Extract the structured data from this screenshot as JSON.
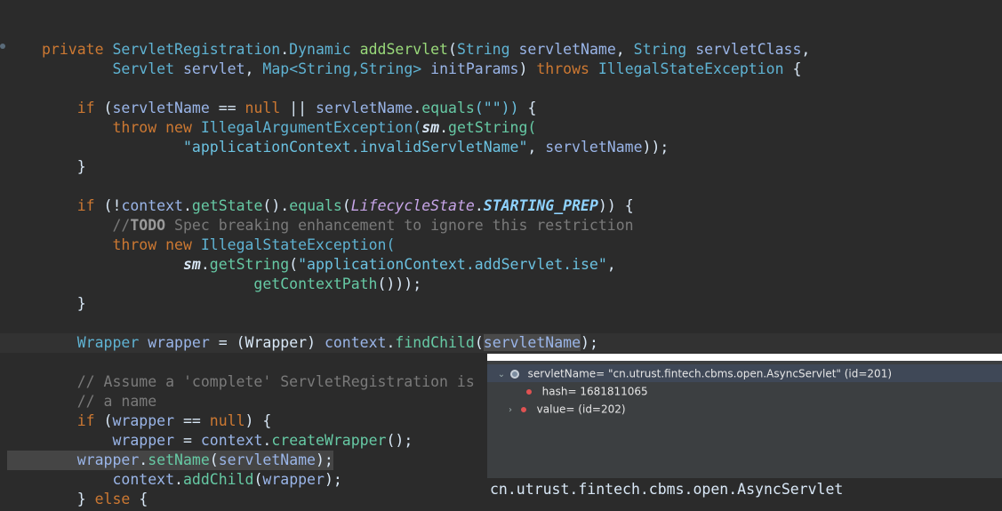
{
  "code": {
    "l1": {
      "kw": "private",
      "type": "ServletRegistration",
      "dot": ".",
      "type2": "Dynamic",
      "fn": "addServlet",
      "p1t": "String",
      "p1": "servletName",
      "p2t": "String",
      "p2": "servletClass",
      "comma": ","
    },
    "l2": {
      "t1": "Servlet",
      "v1": "servlet",
      "t2": "Map<String,String>",
      "v2": "initParams",
      "throws": "throws",
      "ex": "IllegalStateException",
      "brace": "{"
    },
    "l4": {
      "if": "if",
      "v": "servletName",
      "op": "==",
      "null": "null",
      "or": "||",
      "v2": "servletName",
      "m": "equals",
      "arg": "(\"\"))",
      "brace": "{"
    },
    "l5": {
      "throw": "throw",
      "new": "new",
      "ex": "IllegalArgumentException(",
      "sm": "sm",
      "m": "getString("
    },
    "l6": {
      "str": "\"applicationContext.invalidServletName\"",
      "v": "servletName",
      "end": "));"
    },
    "l7": {
      "brace": "}"
    },
    "l9": {
      "if": "if",
      "ctx": "context",
      "m1": "getState",
      "m2": "equals",
      "en": "LifecycleState",
      "enc": "STARTING_PREP",
      "end": ")) {"
    },
    "l10": {
      "slash": "//",
      "todo": "TODO",
      "rest": " Spec breaking enhancement to ignore this restriction"
    },
    "l11": {
      "throw": "throw",
      "new": "new",
      "ex": "IllegalStateException("
    },
    "l12": {
      "sm": "sm",
      "m": "getString",
      "str": "\"applicationContext.addServlet.ise\"",
      "end": ","
    },
    "l13": {
      "m": "getContextPath",
      "end": "()));"
    },
    "l14": {
      "brace": "}"
    },
    "l16": {
      "t": "Wrapper",
      "v": "wrapper",
      "eq": "=",
      "cast": "(Wrapper)",
      "ctx": "context",
      "m": "findChild",
      "arg": "servletName",
      "end": ");"
    },
    "l18": {
      "text": "// Assume a 'complete' ServletRegistration is"
    },
    "l19": {
      "text": "// a name"
    },
    "l20": {
      "if": "if",
      "v": "wrapper",
      "op": "==",
      "null": "null",
      "end": ") {"
    },
    "l21": {
      "v": "wrapper",
      "eq": "=",
      "ctx": "context",
      "m": "createWrapper",
      "end": "();"
    },
    "l22": {
      "v": "wrapper",
      "m": "setName",
      "arg": "servletName",
      "end": ");"
    },
    "l23": {
      "ctx": "context",
      "m": "addChild",
      "arg": "wrapper",
      "end": ");"
    },
    "l24": {
      "brace": "}",
      "else": "else",
      "brace2": "{"
    }
  },
  "popup": {
    "row1": "servletName= \"cn.utrust.fintech.cbms.open.AsyncServlet\" (id=201)",
    "row2": "hash= 1681811065",
    "row3": "value= (id=202)",
    "detail": "cn.utrust.fintech.cbms.open.AsyncServlet"
  }
}
